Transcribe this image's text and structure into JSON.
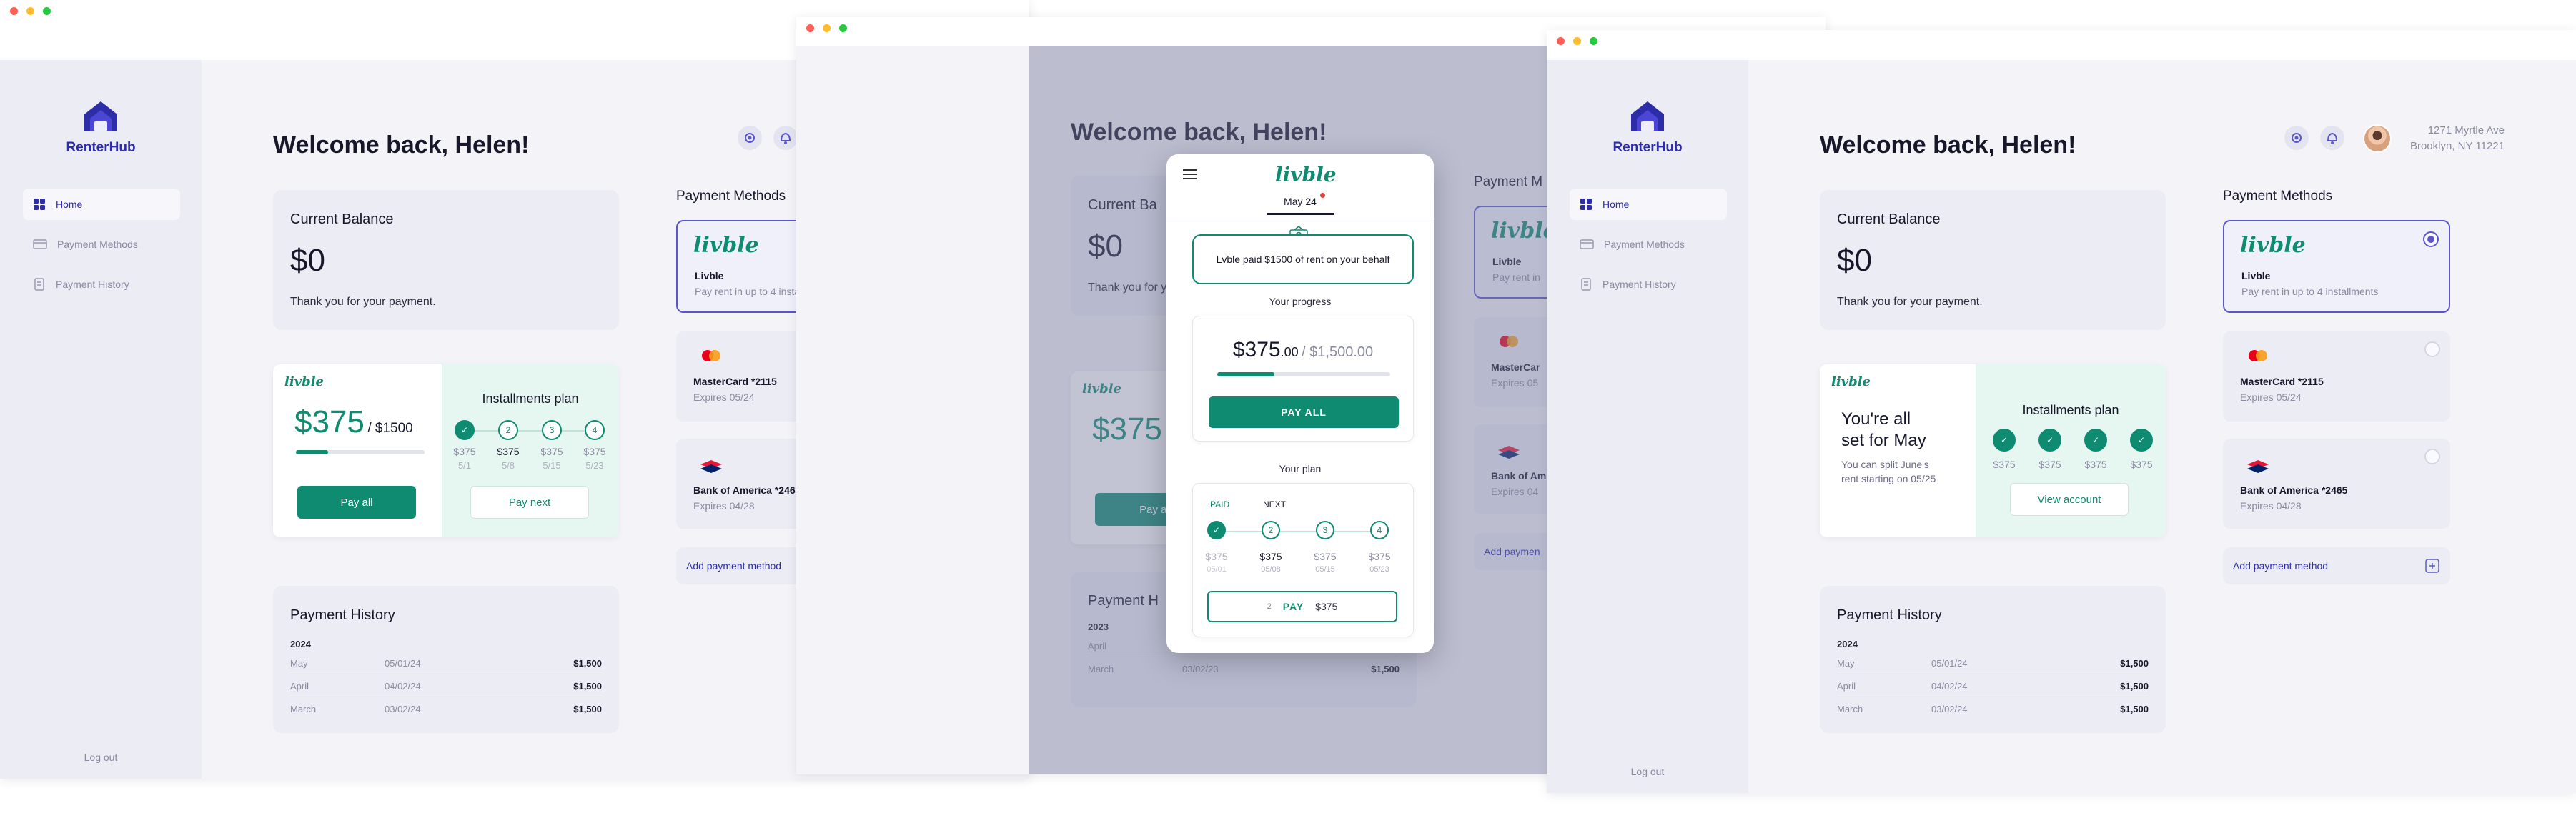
{
  "brand": {
    "name": "RenterHub",
    "accent": "#2d2daa",
    "teal": "#0f8b72"
  },
  "sidebar": {
    "items": [
      {
        "label": "Home",
        "icon": "grid-icon",
        "active": true
      },
      {
        "label": "Payment Methods",
        "icon": "card-icon",
        "active": false
      },
      {
        "label": "Payment History",
        "icon": "receipt-icon",
        "active": false
      }
    ],
    "logout": "Log out"
  },
  "header": {
    "welcome": "Welcome back, Helen!",
    "address_line1": "1271 Myrtle Ave",
    "address_line2": "Brooklyn, NY 11221"
  },
  "balance": {
    "title": "Current Balance",
    "value": "$0",
    "subtitle": "Thank you for your payment."
  },
  "livble_card": {
    "logo": "livble",
    "amount": "$375",
    "total": "/ $1500",
    "progress": 0.25,
    "pay_all": "Pay all",
    "plan_title": "Installments plan",
    "pay_next": "Pay next",
    "steps": [
      {
        "label": "",
        "amount": "$375",
        "date": "5/1",
        "done": true
      },
      {
        "label": "2",
        "amount": "$375",
        "date": "5/8",
        "done": false
      },
      {
        "label": "3",
        "amount": "$375",
        "date": "5/15",
        "done": false
      },
      {
        "label": "4",
        "amount": "$375",
        "date": "5/23",
        "done": false
      }
    ]
  },
  "livble_card_done": {
    "headline_1": "You're all",
    "headline_2": "set for May",
    "sub_1": "You can split June's",
    "sub_2": "rent starting on 05/25",
    "amounts": [
      "$375",
      "$375",
      "$375",
      "$375"
    ],
    "view": "View account"
  },
  "history": {
    "title": "Payment History",
    "year": "2024",
    "rows": [
      {
        "month": "May",
        "date": "05/01/24",
        "amount": "$1,500"
      },
      {
        "month": "April",
        "date": "04/02/24",
        "amount": "$1,500"
      },
      {
        "month": "March",
        "date": "03/02/24",
        "amount": "$1,500"
      }
    ],
    "year_mid": "2023",
    "rows_mid": [
      {
        "month": "April",
        "date": "",
        "amount": ""
      },
      {
        "month": "March",
        "date": "03/02/23",
        "amount": "$1,500"
      }
    ]
  },
  "payment_methods": {
    "title": "Payment Methods",
    "livble_name": "Livble",
    "livble_desc": "Pay rent in up to 4 installments",
    "mc_name": "MasterCard *2115",
    "mc_exp": "Expires 05/24",
    "boa_name": "Bank of America *2465",
    "boa_exp": "Expires 04/28",
    "add": "Add payment method"
  },
  "mid": {
    "title": "Current Ba",
    "pm_title": "Payment M",
    "amount": "$375",
    "pay": "Pay al",
    "hist": "Payment H",
    "livble_short": "Livble",
    "livble_desc_short": "Pay rent in",
    "mc_short": "MasterCar",
    "mc_exp_short": "Expires 05",
    "boa_short": "Bank of Am",
    "boa_exp_short": "Expires 04",
    "add_short": "Add paymen"
  },
  "modal": {
    "tab": "May 24",
    "notice": "Lvble paid $1500 of rent on your behalf",
    "progress_title": "Your progress",
    "amount": "$375",
    "cents": ".00",
    "total": "/ $1,500.00",
    "progress": 0.25,
    "pay_all": "PAY ALL",
    "plan_title": "Your plan",
    "paid": "PAID",
    "next": "NEXT",
    "steps": [
      {
        "label": "",
        "amount": "$375",
        "date": "05/01"
      },
      {
        "label": "2",
        "amount": "$375",
        "date": "05/08"
      },
      {
        "label": "3",
        "amount": "$375",
        "date": "05/15"
      },
      {
        "label": "4",
        "amount": "$375",
        "date": "05/23"
      }
    ],
    "pay_num": "2",
    "pay_label": "PAY",
    "pay_amount": "$375"
  }
}
